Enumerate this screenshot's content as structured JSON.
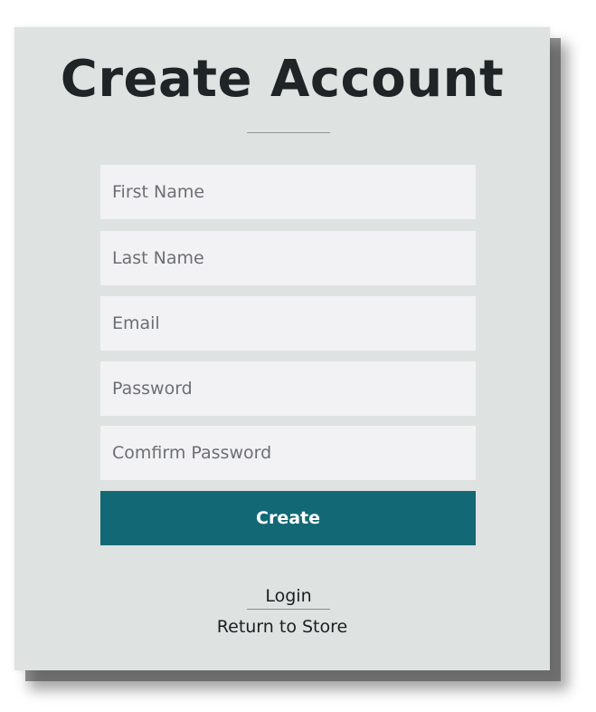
{
  "form": {
    "title": "Create Account",
    "fields": [
      {
        "name": "first_name",
        "placeholder": "First Name",
        "value": ""
      },
      {
        "name": "last_name",
        "placeholder": "Last Name",
        "value": ""
      },
      {
        "name": "email",
        "placeholder": "Email",
        "value": ""
      },
      {
        "name": "password",
        "placeholder": "Password",
        "value": ""
      },
      {
        "name": "confirm_password",
        "placeholder": "Comfirm Password",
        "value": ""
      }
    ],
    "submit_label": "Create"
  },
  "links": {
    "login": "Login",
    "return_to_store": "Return to Store"
  },
  "colors": {
    "card_background": "#dee2e1",
    "input_background": "#f2f2f4",
    "button_background": "#136875",
    "button_text": "#ffffff",
    "title_text": "#1f2426"
  }
}
